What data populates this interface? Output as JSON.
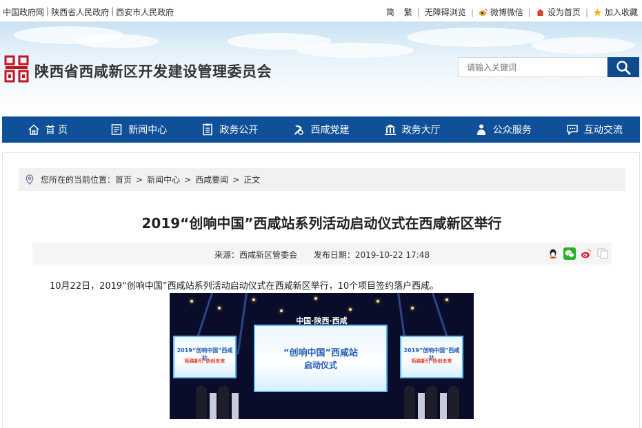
{
  "topbar": {
    "links": [
      "中国政府网",
      "陕西省人民政府",
      "西安市人民政府"
    ],
    "lang_simplified": "简",
    "lang_traditional": "繁",
    "accessibility": "无障碍浏览",
    "weibo_weixin": "微博微信",
    "set_home": "设为首页",
    "add_favorite": "加入收藏"
  },
  "header": {
    "site_title": "陕西省西咸新区开发建设管理委员会",
    "search_placeholder": "请输入关键词"
  },
  "nav": {
    "items": [
      {
        "label": "首 页",
        "icon": "home-icon"
      },
      {
        "label": "新闻中心",
        "icon": "news-icon"
      },
      {
        "label": "政务公开",
        "icon": "document-icon"
      },
      {
        "label": "西咸党建",
        "icon": "party-emblem-icon"
      },
      {
        "label": "政务大厅",
        "icon": "government-hall-icon"
      },
      {
        "label": "公众服务",
        "icon": "people-service-icon"
      },
      {
        "label": "互动交流",
        "icon": "chat-icon"
      }
    ]
  },
  "breadcrumb": {
    "prefix": "您所在的当前位置：",
    "items": [
      "首页",
      "新闻中心",
      "西咸要闻",
      "正文"
    ]
  },
  "article": {
    "title": "2019“创响中国”西咸站系列活动启动仪式在西咸新区举行",
    "source": "来源：西咸新区管委会",
    "date": "发布日期：2019-10-22 17:48",
    "lead": "10月22日，2019“创响中国”西咸站系列活动启动仪式在西咸新区举行，10个项目签约落户西咸。"
  },
  "photo": {
    "banner": "中国·陕西·西咸",
    "main_screen_line1": "“创响中国”西咸站",
    "main_screen_line2": "启动仪式",
    "side_screen_line1": "2019“创响中国”西咸站",
    "side_screen_line2": "拓路新行·协创未来"
  },
  "colors": {
    "nav_bg": "#0f5098",
    "logo_red": "#c0161e",
    "search_btn": "#0e4a8c"
  }
}
